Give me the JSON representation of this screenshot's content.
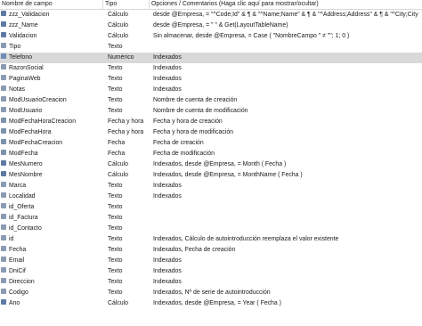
{
  "header": {
    "name": "Nombre de campo",
    "type": "Tipo",
    "options": "Opciones / Comentarios (Haga clic aquí para mostrar/ocultar)"
  },
  "fields": [
    {
      "name": "zzz_Validacion",
      "type": "Cálculo",
      "options": "desde @Empresa, = \"^Code;Id\" & ¶ & \"^Name;Name\" & ¶ & \"^Address;Address\" & ¶ & \"^City;City",
      "icon": "calc-field-icon"
    },
    {
      "name": "zzz_Name",
      "type": "Cálculo",
      "options": "desde @Empresa, = \" \" & Get(LayoutTableName)",
      "icon": "calc-field-icon"
    },
    {
      "name": "Validacion",
      "type": "Cálculo",
      "options": "Sin almacenar, desde @Empresa, = Case ( \"NombreCampo \" ≠ \"\"; 1;        0 )",
      "icon": "calc-field-icon"
    },
    {
      "name": "Tipo",
      "type": "Texto",
      "options": "",
      "icon": "text-field-icon"
    },
    {
      "name": "Telefono",
      "type": "Numérico",
      "options": "Indexados",
      "icon": "number-field-icon",
      "selected": true
    },
    {
      "name": "RazonSocial",
      "type": "Texto",
      "options": "Indexados",
      "icon": "text-field-icon"
    },
    {
      "name": "PaginaWeb",
      "type": "Texto",
      "options": "Indexados",
      "icon": "text-field-icon"
    },
    {
      "name": "Notas",
      "type": "Texto",
      "options": "Indexados",
      "icon": "text-field-icon"
    },
    {
      "name": "ModUsuarioCreacion",
      "type": "Texto",
      "options": "Nombre de cuenta de creación",
      "icon": "text-field-icon"
    },
    {
      "name": "ModUsuario",
      "type": "Texto",
      "options": "Nombre de cuenta de modificación",
      "icon": "text-field-icon"
    },
    {
      "name": "ModFechaHoraCreacion",
      "type": "Fecha y hora",
      "options": "Fecha y hora de creación",
      "icon": "timestamp-field-icon"
    },
    {
      "name": "ModFechaHora",
      "type": "Fecha y hora",
      "options": "Fecha y hora de modificación",
      "icon": "timestamp-field-icon"
    },
    {
      "name": "ModFechaCreacion",
      "type": "Fecha",
      "options": "Fecha de creación",
      "icon": "date-field-icon"
    },
    {
      "name": "ModFecha",
      "type": "Fecha",
      "options": "Fecha de modificación",
      "icon": "date-field-icon"
    },
    {
      "name": "MesNumero",
      "type": "Cálculo",
      "options": "Indexados, desde @Empresa, = Month ( Fecha )",
      "icon": "calc-field-icon"
    },
    {
      "name": "MesNombre",
      "type": "Cálculo",
      "options": "Indexados, desde @Empresa, = MonthName ( Fecha )",
      "icon": "calc-field-icon"
    },
    {
      "name": "Marca",
      "type": "Texto",
      "options": "Indexados",
      "icon": "text-field-icon"
    },
    {
      "name": "Localidad",
      "type": "Texto",
      "options": "Indexados",
      "icon": "text-field-icon"
    },
    {
      "name": "id_Oferta",
      "type": "Texto",
      "options": "",
      "icon": "text-field-icon"
    },
    {
      "name": "id_Factura",
      "type": "Texto",
      "options": "",
      "icon": "text-field-icon"
    },
    {
      "name": "id_Contacto",
      "type": "Texto",
      "options": "",
      "icon": "text-field-icon"
    },
    {
      "name": "id",
      "type": "Texto",
      "options": "Indexados, Cálculo de autointroducción reemplaza el valor existente",
      "icon": "text-field-icon"
    },
    {
      "name": "Fecha",
      "type": "Texto",
      "options": "Indexados, Fecha de creación",
      "icon": "text-field-icon"
    },
    {
      "name": "Email",
      "type": "Texto",
      "options": "Indexados",
      "icon": "text-field-icon"
    },
    {
      "name": "DniCif",
      "type": "Texto",
      "options": "Indexados",
      "icon": "text-field-icon"
    },
    {
      "name": "Direccion",
      "type": "Texto",
      "options": "Indexados",
      "icon": "text-field-icon"
    },
    {
      "name": "Codigo",
      "type": "Texto",
      "options": "Indexados, Nº de serie de autointroducción",
      "icon": "text-field-icon"
    },
    {
      "name": "Ano",
      "type": "Cálculo",
      "options": "Indexados, desde @Empresa, = Year ( Fecha )",
      "icon": "calc-field-icon"
    }
  ],
  "colors": {
    "selected_row": "#d9d9d9",
    "header_border": "#d8d8d8"
  }
}
